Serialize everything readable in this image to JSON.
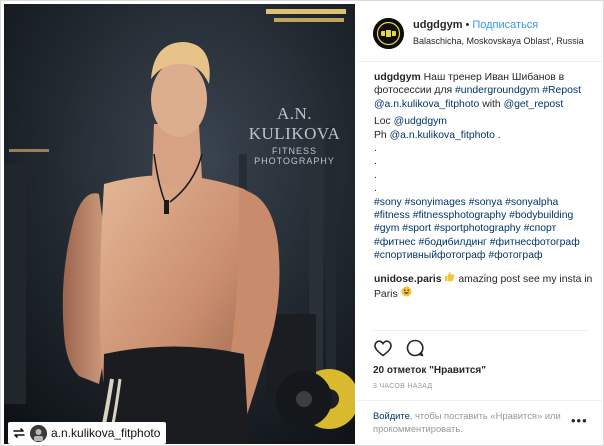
{
  "photo": {
    "watermark_name": "A.N. KULIKOVA",
    "watermark_sub": "FITNESS PHOTOGRAPHY",
    "repost_handle": "a.n.kulikova_fitphoto",
    "icons": {
      "repost": "repost-icon"
    }
  },
  "header": {
    "username": "udgdgym",
    "separator": "•",
    "follow_label": "Подписаться",
    "location": "Balaschicha, Moskovskaya Oblast', Russia"
  },
  "caption": {
    "author": "udgdgym",
    "text1": "Наш тренер Иван Шибанов в фотосессии для",
    "tag1": "#undergroundgym",
    "tag2": "#Repost",
    "mention1": "@a.n.kulikova_fitphoto",
    "with": "with",
    "mention2": "@get_repost",
    "loc_prefix": "Loc",
    "loc_mention": "@udgdgym",
    "ph_prefix": "Ph",
    "ph_mention": "@a.n.kulikova_fitphoto",
    "ph_suffix": ".",
    "dots": [
      ".",
      ".",
      ".",
      "."
    ],
    "hashtags": [
      "#sony #sonyimages #sonya #sonyalpha",
      "#fitness #fitnessphotography #bodybuilding",
      "#gym #sport #sportphotography #спорт",
      "#фитнес #бодибилдинг #фитнесфотограф",
      "#спортивныйфотограф #фотограф"
    ]
  },
  "comment": {
    "author": "unidose.paris",
    "text": "amazing post see my insta in Paris"
  },
  "actions": {
    "likes": "20 отметок \"Нравится\"",
    "time": "3 ЧАСОВ НАЗАД",
    "icons": {
      "like": "heart-icon",
      "comment": "comment-icon",
      "more": "more-icon"
    }
  },
  "login": {
    "link": "Войдите",
    "text": ", чтобы поставить «Нравится» или прокомментировать.",
    "more_label": "•••"
  },
  "colors": {
    "link_blue": "#3897f0",
    "tag_blue": "#003569",
    "muted": "#999999"
  }
}
